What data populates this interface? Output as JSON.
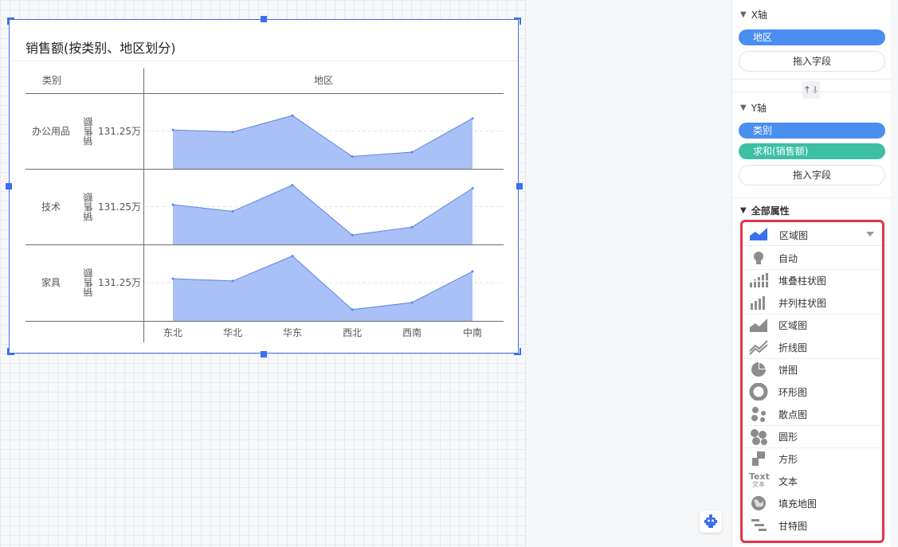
{
  "chart": {
    "title": "销售额(按类别、地区划分)",
    "row_header": "类别",
    "col_header": "地区",
    "measure_label": "销售额",
    "tick_label": "131.25万"
  },
  "chart_data": {
    "type": "area",
    "title": "销售额(按类别、地区划分)",
    "xlabel": "地区",
    "ylabel": "销售额",
    "categories": [
      "东北",
      "华北",
      "华东",
      "西北",
      "西南",
      "中南"
    ],
    "y_tick": "131.25万",
    "y_tick_value": 1312500,
    "series": [
      {
        "name": "办公用品",
        "values": [
          1350000,
          1280000,
          1850000,
          430000,
          580000,
          1750000
        ]
      },
      {
        "name": "技术",
        "values": [
          1380000,
          1150000,
          2060000,
          330000,
          600000,
          1950000
        ]
      },
      {
        "name": "家具",
        "values": [
          1450000,
          1370000,
          2230000,
          390000,
          630000,
          1700000
        ]
      }
    ],
    "fill_color": "#a9c1f7",
    "stroke_color": "#5b86e5"
  },
  "panel": {
    "x_axis": {
      "title": "X轴",
      "fields": [
        "地区"
      ],
      "drop": "拖入字段"
    },
    "swap_icon": "↑↓",
    "y_axis": {
      "title": "Y轴",
      "fields": [
        "类别",
        "求和(销售额)"
      ],
      "drop": "拖入字段"
    },
    "all_props": "全部属性",
    "chart_type": {
      "selected": "区域图",
      "options": [
        "自动",
        "堆叠柱状图",
        "并列柱状图",
        "区域图",
        "折线图",
        "饼图",
        "环形图",
        "散点图",
        "圆形",
        "方形",
        "文本",
        "填充地图",
        "甘特图"
      ]
    },
    "text_icon_label": "Text",
    "text_icon_sub": "文本"
  },
  "colors": {
    "accent": "#3b6ef0",
    "pill_blue": "#4a8ef0",
    "pill_green": "#3cbfa3",
    "highlight": "#e5334b"
  }
}
